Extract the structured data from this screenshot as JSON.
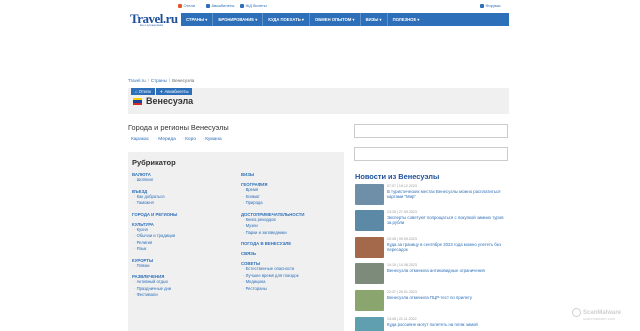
{
  "topbar": {
    "links": [
      {
        "label": "Отели",
        "icon": "hotel-icon",
        "color": "#e05a2b"
      },
      {
        "label": "Авиабилеты",
        "icon": "plane-icon",
        "color": "#2d6fb8"
      },
      {
        "label": "ЖД билеты",
        "icon": "train-icon",
        "color": "#2d6fb8"
      }
    ],
    "forums": {
      "label": "Форумы",
      "icon": "forum-icon",
      "color": "#2d6fb8"
    }
  },
  "logo": {
    "main": "Travel.ru",
    "sub": "все о путешествиях"
  },
  "nav": {
    "items": [
      "СТРАНЫ ▾",
      "БРОНИРОВАНИЕ ▾",
      "КУДА ПОЕХАТЬ ▾",
      "ОБМЕН ОПЫТОМ ▾",
      "ВИЗЫ ▾",
      "ПОЛЕЗНОЕ ▾"
    ],
    "color": "#2d6fb8"
  },
  "breadcrumb": [
    "Travel.ru",
    "Страны",
    "Венесуэла"
  ],
  "country": {
    "tabs": [
      "⌂ Отели",
      "✈ Авиабилеты"
    ],
    "title": "Венесуэла",
    "flag_colors": [
      "#f5d000",
      "#1d3f9a",
      "#d52b1e"
    ]
  },
  "regions": {
    "title": "Города и регионы Венесуэлы",
    "items": [
      "Каракас",
      "Мерида",
      "Коро",
      "Кумана"
    ]
  },
  "rubricator": {
    "title": "Рубрикатор",
    "left": [
      {
        "heading": "ВАЛЮТА",
        "items": [
          "Шоппинг"
        ]
      },
      {
        "heading": "ВЪЕЗД",
        "items": [
          "Как добраться",
          "Таможня"
        ]
      },
      {
        "heading": "ГОРОДА И РЕГИОНЫ",
        "items": []
      },
      {
        "heading": "КУЛЬТУРА",
        "items": [
          "Кухня",
          "Обычаи и традиции",
          "Религия",
          "Язык"
        ]
      },
      {
        "heading": "КУРОРТЫ",
        "items": [
          "Пляжи"
        ]
      },
      {
        "heading": "РАЗВЛЕЧЕНИЯ",
        "items": [
          "Активный отдых",
          "Праздничные дни",
          "Фестивали"
        ]
      }
    ],
    "right": [
      {
        "heading": "ВИЗЫ",
        "items": []
      },
      {
        "heading": "ГЕОГРАФИЯ",
        "items": [
          "Время",
          "Климат",
          "Природа"
        ]
      },
      {
        "heading": "ДОСТОПРИМЕЧАТЕЛЬНОСТИ",
        "items": [
          "Книга рекордов",
          "Музеи",
          "Парки и заповедники"
        ]
      },
      {
        "heading": "ПОГОДА В ВЕНЕСУЭЛЕ",
        "items": []
      },
      {
        "heading": "СВЯЗЬ",
        "items": []
      },
      {
        "heading": "СОВЕТЫ",
        "items": [
          "Естественные опасности",
          "Лучшее время для поездок",
          "Медицина",
          "Рестораны"
        ]
      }
    ]
  },
  "news": {
    "title": "Новости из Венесуэлы",
    "items": [
      {
        "date": "07:07 | 18.12.2023",
        "text": "В туристических местах Венесуэлы можно расплатиться картами \"Мир\"",
        "thumb": "#6f8fa8"
      },
      {
        "date": "13:35 | 27.09.2023",
        "text": "Эксперты советуют попрощаться с покупкой зимних туров за рубли",
        "thumb": "#5c8aa6"
      },
      {
        "date": "20:45 | 09.09.2023",
        "text": "Куда за границу в сентябре 2023 года можно улететь без пересадок",
        "thumb": "#a4684a"
      },
      {
        "date": "14:10 | 10.08.2023",
        "text": "Венесуэла отменила антиковидные ограничения",
        "thumb": "#7d8c7a"
      },
      {
        "date": "22:37 | 26.01.2023",
        "text": "Венесуэла отменила ПЦР-тест по прилету",
        "thumb": "#8aa56e"
      },
      {
        "date": "13:45 | 21.11.2022",
        "text": "Куда россияне могут полететь на пляж зимой",
        "thumb": "#5f9fb0"
      }
    ]
  },
  "watermark": {
    "text": "ScanMalware",
    "sub": "scanmalware.com"
  }
}
